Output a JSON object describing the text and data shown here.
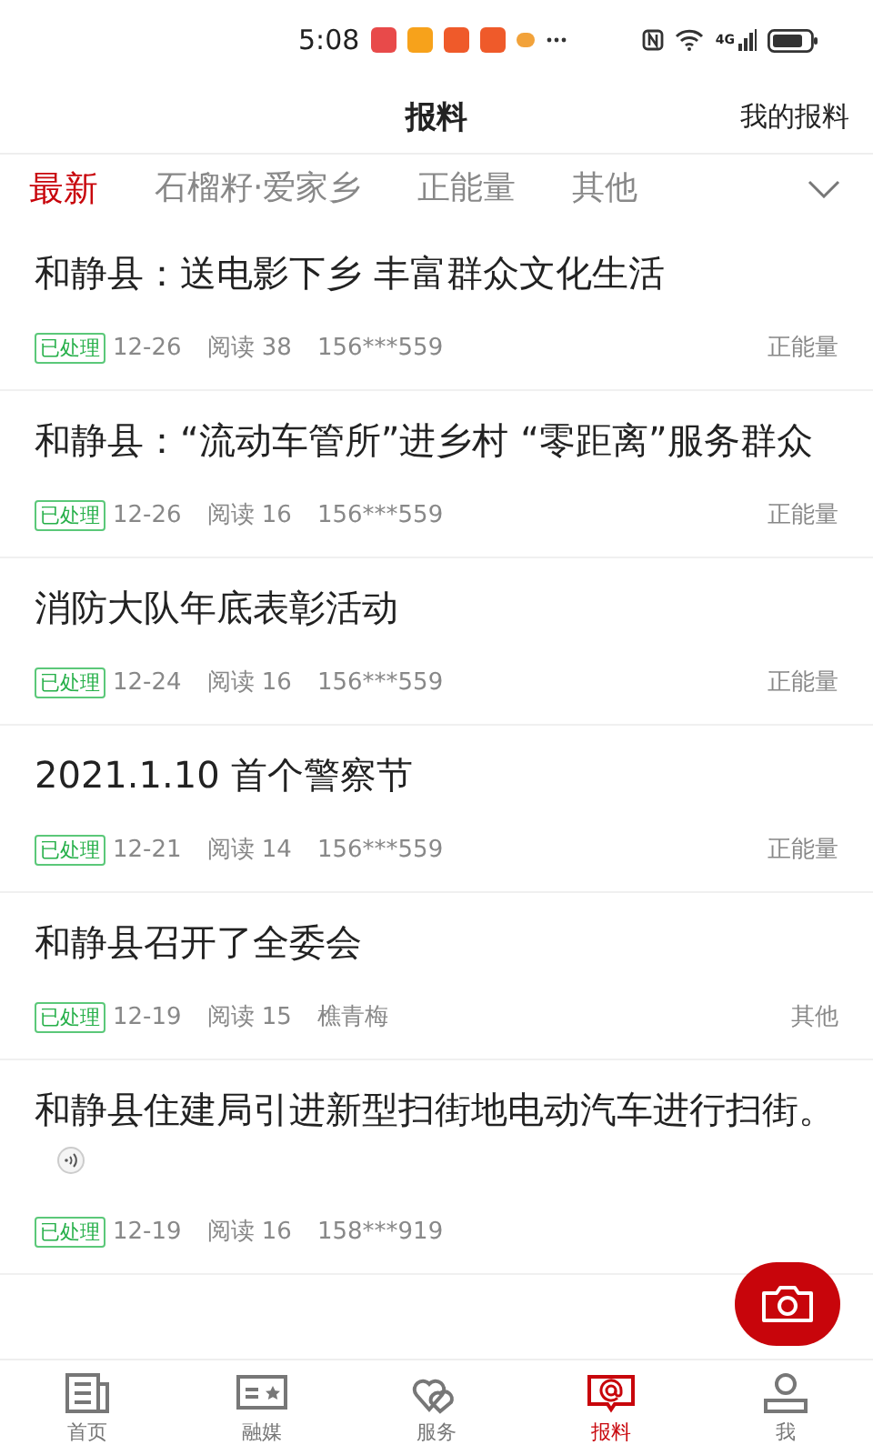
{
  "status_bar": {
    "time": "5:08",
    "network": "4G"
  },
  "header": {
    "title": "报料",
    "action": "我的报料"
  },
  "tabs": [
    {
      "label": "最新",
      "selected": true
    },
    {
      "label": "石榴籽·爱家乡",
      "selected": false
    },
    {
      "label": "正能量",
      "selected": false
    },
    {
      "label": "其他",
      "selected": false
    }
  ],
  "posts": [
    {
      "title": "和静县：送电影下乡 丰富群众文化生活",
      "audio": false,
      "status": "已处理",
      "date": "12-26",
      "reads": "阅读 38",
      "author": "156***559",
      "category": "正能量"
    },
    {
      "title": "和静县：“流动车管所”进乡村 “零距离”服务群众",
      "audio": false,
      "status": "已处理",
      "date": "12-26",
      "reads": "阅读 16",
      "author": "156***559",
      "category": "正能量"
    },
    {
      "title": "消防大队年底表彰活动",
      "audio": false,
      "status": "已处理",
      "date": "12-24",
      "reads": "阅读 16",
      "author": "156***559",
      "category": "正能量"
    },
    {
      "title": "2021.1.10 首个警察节",
      "audio": false,
      "status": "已处理",
      "date": "12-21",
      "reads": "阅读 14",
      "author": "156***559",
      "category": "正能量"
    },
    {
      "title": "和静县召开了全委会",
      "audio": false,
      "status": "已处理",
      "date": "12-19",
      "reads": "阅读 15",
      "author": "樵青梅",
      "category": "其他"
    },
    {
      "title": "和静县住建局引进新型扫街地电动汽车进行扫街。",
      "audio": true,
      "status": "已处理",
      "date": "12-19",
      "reads": "阅读 16",
      "author": "158***919"
    }
  ],
  "nav": [
    {
      "label": "首页",
      "selected": false
    },
    {
      "label": "融媒",
      "selected": false
    },
    {
      "label": "服务",
      "selected": false
    },
    {
      "label": "报料",
      "selected": true
    },
    {
      "label": "我",
      "selected": false
    }
  ]
}
